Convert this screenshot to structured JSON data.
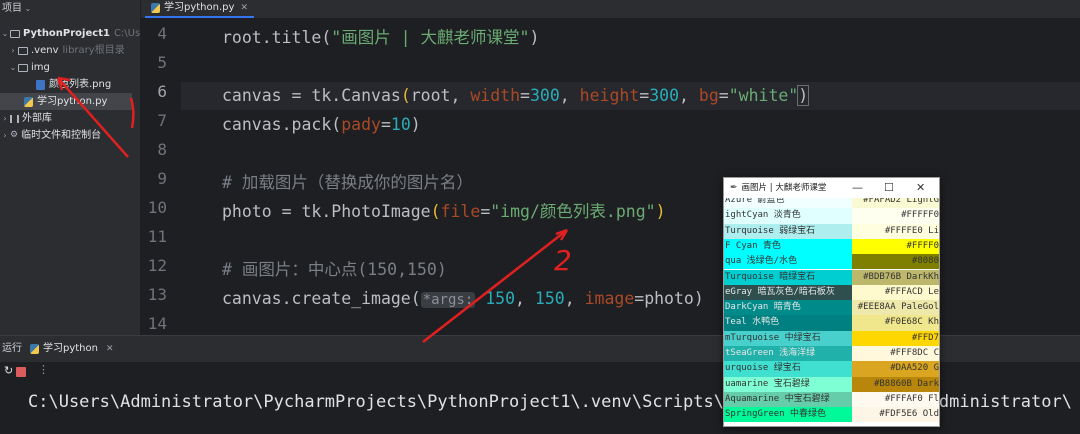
{
  "sidebar": {
    "header": "项目",
    "project_name": "PythonProject1",
    "project_path": "C:\\Users\\Ac",
    "venv_label": ".venv",
    "venv_note": "library根目录",
    "img_folder": "img",
    "img_file": "颜色列表.png",
    "py_file": "学习python.py",
    "external_libs": "外部库",
    "scratches": "临时文件和控制台"
  },
  "editor": {
    "tab_label": "学习python.py",
    "line_numbers": [
      "4",
      "5",
      "6",
      "7",
      "8",
      "9",
      "10",
      "11",
      "12",
      "13",
      "14"
    ],
    "current_line_index": 2
  },
  "code": {
    "l4_a": "root.title(",
    "l4_str": "\"画图片 | 大麒老师课堂\"",
    "l4_b": ")",
    "l6_a": "canvas = tk.Canvas",
    "l6_paren": "(",
    "l6_b": "root, ",
    "l6_kw1": "width",
    "l6_eq1": "=",
    "l6_n1": "300",
    "l6_c1": ", ",
    "l6_kw2": "height",
    "l6_eq2": "=",
    "l6_n2": "300",
    "l6_c2": ", ",
    "l6_kw3": "bg",
    "l6_eq3": "=",
    "l6_str": "\"white\"",
    "l6_close": ")",
    "l7_a": "canvas.pack(",
    "l7_kw": "pady",
    "l7_eq": "=",
    "l7_n": "10",
    "l7_b": ")",
    "l9_cmt": "# 加载图片（替换成你的图片名）",
    "l10_a": "photo = tk.PhotoImage",
    "l10_paren": "(",
    "l10_kw": "file",
    "l10_eq": "=",
    "l10_str": "\"img/颜色列表.png\"",
    "l10_close": ")",
    "l12_cmt": "# 画图片：中心点(150,150)",
    "l13_a": "canvas.create_image(",
    "l13_hint": "*args:",
    "l13_n1": " 150",
    "l13_c1": ", ",
    "l13_n2": "150",
    "l13_c2": ", ",
    "l13_kw": "image",
    "l13_eq": "=",
    "l13_b": "photo)"
  },
  "run": {
    "label": "运行",
    "tab": "学习python",
    "console_line": "C:\\Users\\Administrator\\PycharmProjects\\PythonProject1\\.venv\\Scripts\\python.exe C:\\Users\\Administrator\\"
  },
  "tk_window": {
    "title": "画图片 | 大麒老师课堂",
    "minimize": "—",
    "maximize": "☐",
    "close": "✕",
    "rows": [
      {
        "left": "Azure 蔚蓝色",
        "lcolor": "#F0FFFF",
        "ltext": "#333333",
        "right": "#FAFAD2 LightG",
        "rcolor": "#FAFAD2",
        "rtext": "#333333"
      },
      {
        "left": "ightCyan 淡青色",
        "lcolor": "#E0FFFF",
        "ltext": "#333333",
        "right": "#FFFFF0",
        "rcolor": "#FFFFF0",
        "rtext": "#333333"
      },
      {
        "left": "Turquoise 弱绿宝石",
        "lcolor": "#AFEEEE",
        "ltext": "#333333",
        "right": "#FFFFE0 Li",
        "rcolor": "#FFFFE0",
        "rtext": "#333333"
      },
      {
        "left": "F Cyan 青色",
        "lcolor": "#00FFFF",
        "ltext": "#333333",
        "right": "#FFFF0",
        "rcolor": "#FFFF00",
        "rtext": "#333333"
      },
      {
        "left": "qua 浅绿色/水色",
        "lcolor": "#00FFFF",
        "ltext": "#333333",
        "right": "#8080",
        "rcolor": "#808000",
        "rtext": "#333333"
      },
      {
        "left": "Turquoise 暗绿宝石",
        "lcolor": "#00CED1",
        "ltext": "#333333",
        "right": "#BDB76B DarkKh",
        "rcolor": "#BDB76B",
        "rtext": "#333333"
      },
      {
        "left": "eGray 暗瓦灰色/暗石板灰",
        "lcolor": "#2F4F4F",
        "ltext": "#e6e6e6",
        "right": "#FFFACD Le",
        "rcolor": "#FFFACD",
        "rtext": "#333333"
      },
      {
        "left": "DarkCyan 暗青色",
        "lcolor": "#008B8B",
        "ltext": "#e6e6e6",
        "right": "#EEE8AA PaleGol",
        "rcolor": "#EEE8AA",
        "rtext": "#333333"
      },
      {
        "left": "Teal 水鸭色",
        "lcolor": "#008080",
        "ltext": "#e6e6e6",
        "right": "#F0E68C Kh",
        "rcolor": "#F0E68C",
        "rtext": "#333333"
      },
      {
        "left": "mTurquoise 中绿宝石",
        "lcolor": "#48D1CC",
        "ltext": "#333333",
        "right": "#FFD7",
        "rcolor": "#FFD700",
        "rtext": "#333333"
      },
      {
        "left": "tSeaGreen 浅海洋绿",
        "lcolor": "#20B2AA",
        "ltext": "#e6e6e6",
        "right": "#FFF8DC C",
        "rcolor": "#FFF8DC",
        "rtext": "#333333"
      },
      {
        "left": "urquoise 绿宝石",
        "lcolor": "#40E0D0",
        "ltext": "#333333",
        "right": "#DAA520 G",
        "rcolor": "#DAA520",
        "rtext": "#333333"
      },
      {
        "left": "uamarine 宝石碧绿",
        "lcolor": "#7FFFD4",
        "ltext": "#333333",
        "right": "#B8860B Dark",
        "rcolor": "#B8860B",
        "rtext": "#333333"
      },
      {
        "left": "Aquamarine 中宝石碧绿",
        "lcolor": "#66CDAA",
        "ltext": "#333333",
        "right": "#FFFAF0 Fl",
        "rcolor": "#FFFAF0",
        "rtext": "#333333"
      },
      {
        "left": "SpringGreen 中春绿色",
        "lcolor": "#00FA9A",
        "ltext": "#333333",
        "right": "#FDF5E6 Old",
        "rcolor": "#FDF5E6",
        "rtext": "#333333"
      }
    ]
  },
  "annotation": {
    "mark_label": "2"
  },
  "colors": {
    "ide_bg": "#1e1f22",
    "panel_bg": "#2b2d30",
    "string": "#6aab73",
    "keyword_arg": "#aa4926",
    "number": "#2aacb8",
    "comment": "#7a7e85",
    "annotation_red": "#e02020"
  }
}
